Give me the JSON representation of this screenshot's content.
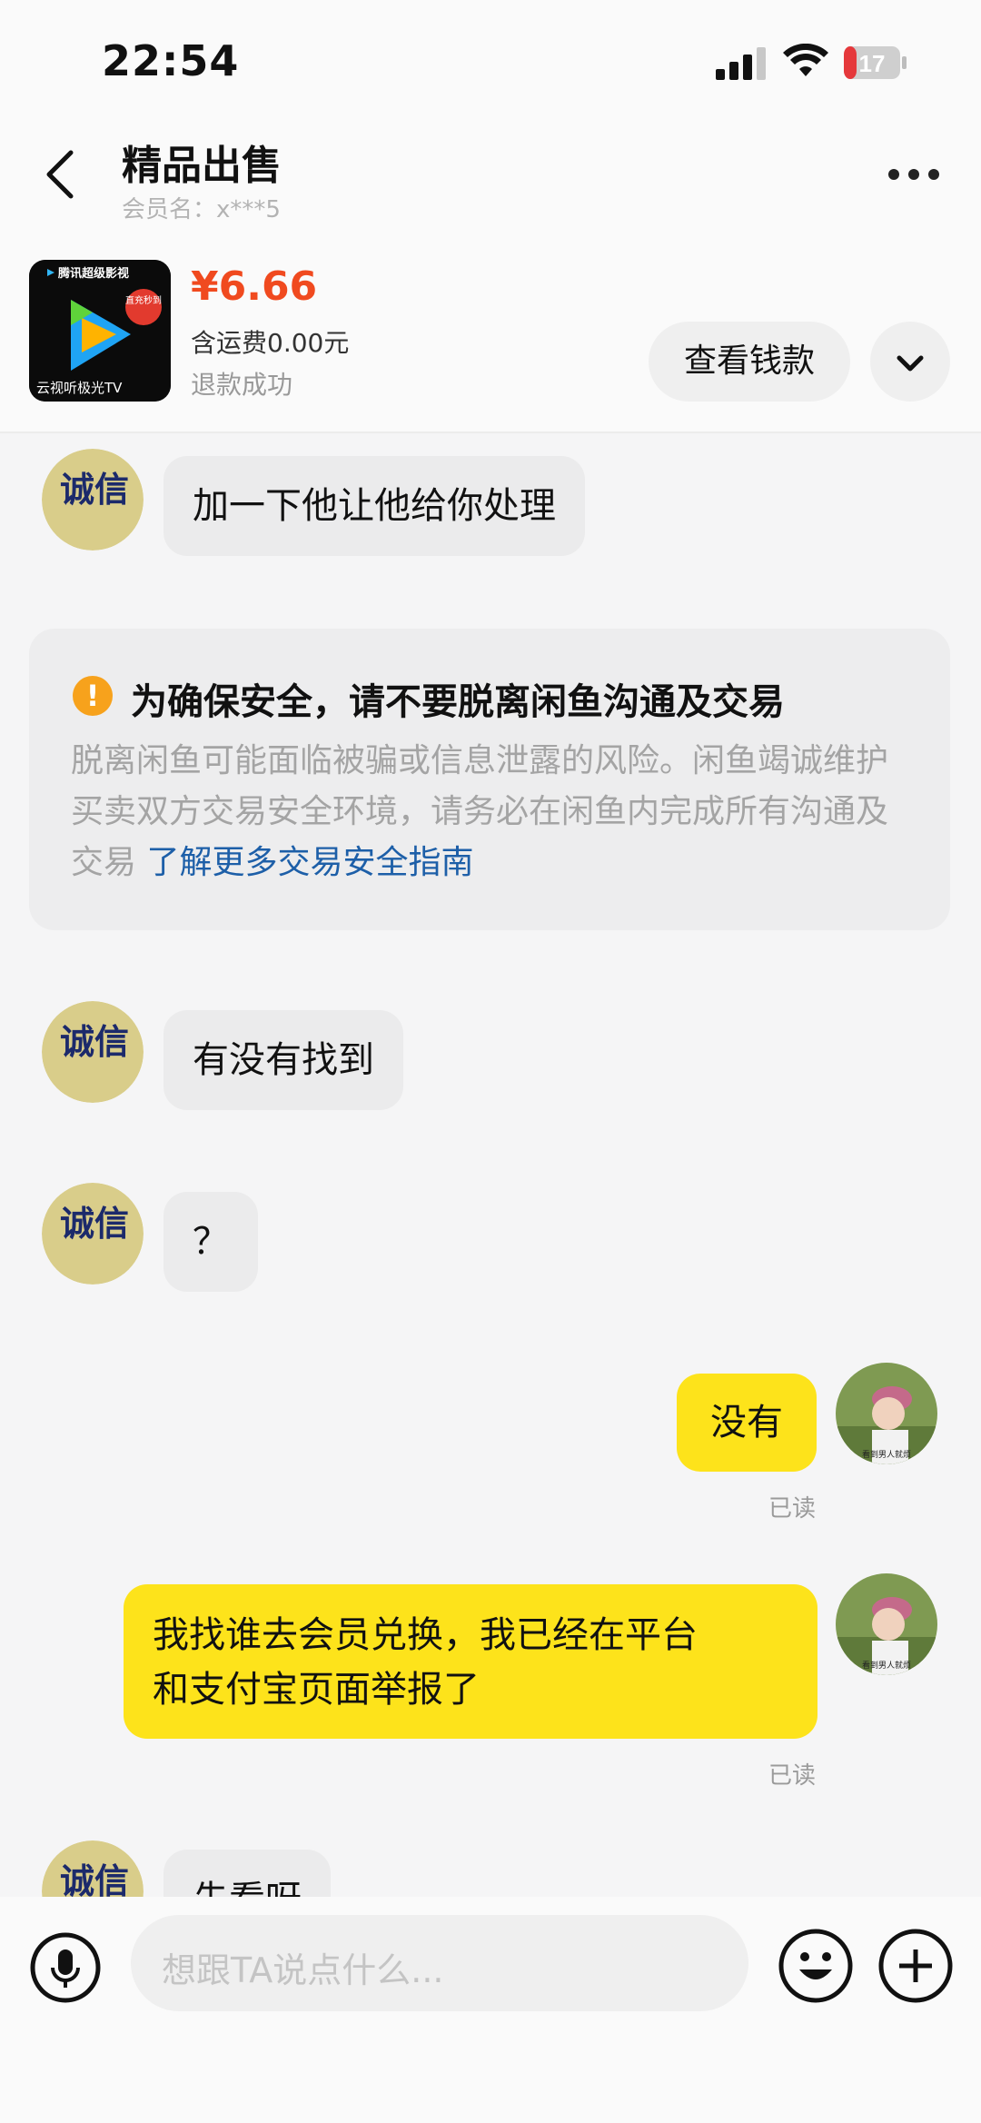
{
  "status_bar": {
    "time": "22:54",
    "battery": "17"
  },
  "header": {
    "title": "精品出售",
    "member": "会员名：x***5"
  },
  "product": {
    "thumb_text_top": "腾讯超级影视",
    "thumb_badge": "直充秒到",
    "thumb_text_bottom": "云视听极光TV",
    "price": "¥6.66",
    "shipping": "含运费0.00元",
    "refund_status": "退款成功",
    "check_button": "查看钱款"
  },
  "notice": {
    "icon": "!",
    "title": "为确保安全，请不要脱离闲鱼沟通及交易",
    "body": "脱离闲鱼可能面临被骗或信息泄露的风险。闲鱼竭诚维护买卖双方交易安全环境，请务必在闲鱼内完成所有沟通及交易",
    "link": "了解更多交易安全指南"
  },
  "messages": [
    {
      "side": "left",
      "text": "加一下他让他给你处理"
    },
    {
      "side": "left",
      "text": "有没有找到"
    },
    {
      "side": "left",
      "text": "？"
    },
    {
      "side": "right",
      "text": "没有",
      "status": "已读"
    },
    {
      "side": "right",
      "line1": "我找谁去会员兑换，我已经在平台",
      "line2": "和支付宝页面举报了",
      "status": "已读"
    },
    {
      "side": "left",
      "text": "先看呀"
    }
  ],
  "avatar_left_text": "诚信",
  "avatar_right_caption": "看到男人就烦",
  "input": {
    "placeholder": "想跟TA说点什么..."
  },
  "colors": {
    "accent_yellow": "#fde31b",
    "price_red": "#f04a1f",
    "link_blue": "#1d5fa8",
    "warning_orange": "#f7a21c"
  }
}
